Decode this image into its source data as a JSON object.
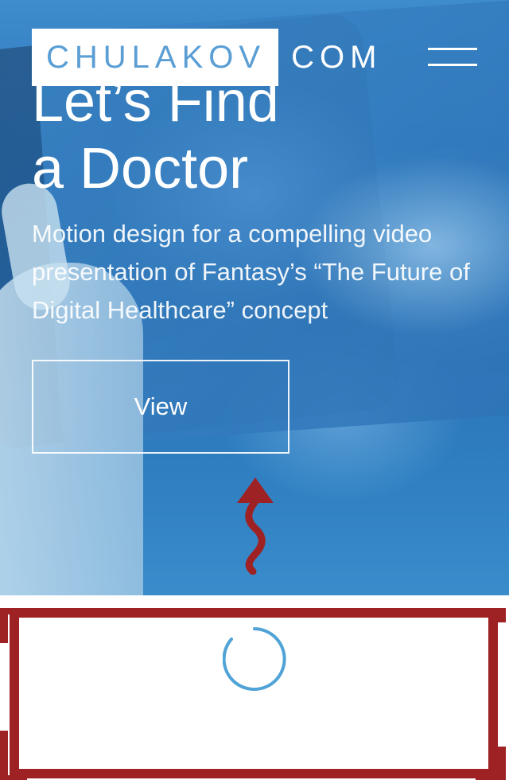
{
  "header": {
    "logo_box_text": "CHULAKOV",
    "logo_rest_text": "COM",
    "menu_icon": "hamburger-menu-icon"
  },
  "hero": {
    "title_line1": "Let’s Find",
    "title_line2": "a Doctor",
    "description": "Motion design for a compelling video presentation of Fantasy’s “The Future of Digital Healthcare” concept",
    "view_button_label": "View",
    "arrow_icon": "wavy-up-arrow-icon"
  },
  "loader": {
    "icon": "loading-spinner-icon"
  },
  "colors": {
    "accent_red": "#9e2224",
    "logo_blue": "#5a9ed4",
    "spinner_blue": "#4fa3d6"
  }
}
